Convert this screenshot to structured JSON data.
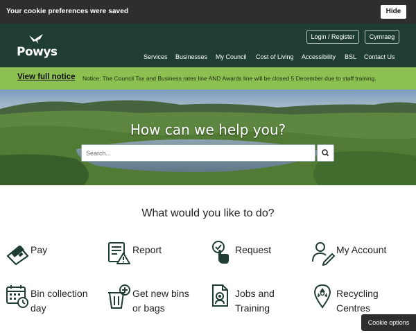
{
  "cookie_bar": {
    "message": "Your cookie preferences were saved",
    "hide_label": "Hide"
  },
  "header": {
    "logo_text": "Powys",
    "login_label": "Login / Register",
    "language_label": "Cymraeg",
    "nav": [
      "Services",
      "Businesses",
      "My Council",
      "Cost of Living",
      "Accessibility",
      "BSL",
      "Contact Us"
    ]
  },
  "notice": {
    "link_text": "View full notice",
    "text": "Notice: The Council Tax and Business rates line AND Awards line will be closed 5 December due to staff training."
  },
  "hero": {
    "title": "How can we help you?",
    "search_placeholder": "Search..."
  },
  "tasks": {
    "heading": "What would you like to do?",
    "items": [
      {
        "label_lines": [
          "Pay"
        ],
        "icon": "credit-card-icon"
      },
      {
        "label_lines": [
          "Report"
        ],
        "icon": "report-warning-icon"
      },
      {
        "label_lines": [
          "Request"
        ],
        "icon": "hand-check-icon"
      },
      {
        "label_lines": [
          "My Account"
        ],
        "icon": "user-edit-icon"
      },
      {
        "label_lines": [
          "Bin collection",
          "day"
        ],
        "icon": "calendar-icon"
      },
      {
        "label_lines": [
          "Get new bins",
          "or bags"
        ],
        "icon": "bin-plus-icon"
      },
      {
        "label_lines": [
          "Jobs and",
          "Training"
        ],
        "icon": "job-document-icon"
      },
      {
        "label_lines": [
          "Recycling",
          "Centres"
        ],
        "icon": "recycling-pin-icon"
      }
    ]
  },
  "cookie_options_label": "Cookie options",
  "colors": {
    "cookie_bar": "#2e2e2e",
    "header": "#1f3d33",
    "notice": "#8cc152",
    "icon": "#1f3d33"
  }
}
